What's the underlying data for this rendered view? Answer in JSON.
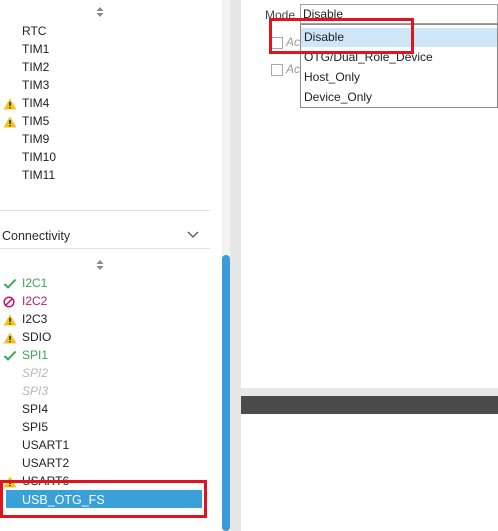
{
  "left_tree": {
    "timers_items": [
      {
        "label": "RTC",
        "status": "none"
      },
      {
        "label": "TIM1",
        "status": "none"
      },
      {
        "label": "TIM2",
        "status": "none"
      },
      {
        "label": "TIM3",
        "status": "none"
      },
      {
        "label": "TIM4",
        "status": "warning"
      },
      {
        "label": "TIM5",
        "status": "warning"
      },
      {
        "label": "TIM9",
        "status": "none"
      },
      {
        "label": "TIM10",
        "status": "none"
      },
      {
        "label": "TIM11",
        "status": "none"
      }
    ],
    "connectivity": {
      "title": "Connectivity",
      "items": [
        {
          "label": "I2C1",
          "status": "ok"
        },
        {
          "label": "I2C2",
          "status": "error"
        },
        {
          "label": "I2C3",
          "status": "warning"
        },
        {
          "label": "SDIO",
          "status": "warning"
        },
        {
          "label": "SPI1",
          "status": "ok"
        },
        {
          "label": "SPI2",
          "status": "disabled"
        },
        {
          "label": "SPI3",
          "status": "disabled"
        },
        {
          "label": "SPI4",
          "status": "none"
        },
        {
          "label": "SPI5",
          "status": "none"
        },
        {
          "label": "USART1",
          "status": "none"
        },
        {
          "label": "USART2",
          "status": "none"
        },
        {
          "label": "USART6",
          "status": "warning"
        }
      ],
      "selected_item": "USB_OTG_FS"
    }
  },
  "config": {
    "mode_label": "Mode",
    "mode_value": "Disable",
    "checkbox1_label": "Ac",
    "checkbox2_label": "Ac",
    "dropdown_options": [
      "Disable",
      "OTG/Dual_Role_Device",
      "Host_Only",
      "Device_Only"
    ],
    "selected_option": "Disable"
  },
  "colors": {
    "ok": "#3aa552",
    "error": "#c0166e",
    "warning": "#f0c419",
    "selection": "#3aa1d8",
    "highlight_box": "#e0141e",
    "scroll_thumb": "#3b9ad9"
  }
}
